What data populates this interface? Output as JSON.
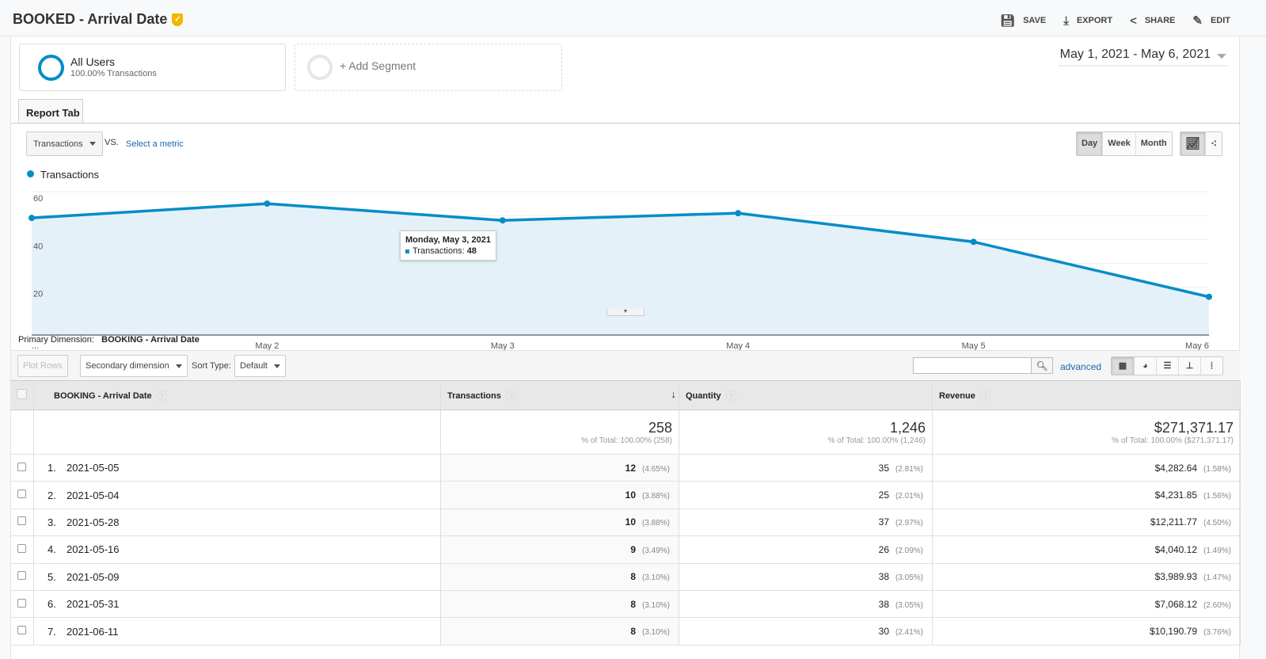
{
  "header": {
    "title": "BOOKED - Arrival Date",
    "actions": [
      {
        "icon": "save-icon",
        "label": "SAVE"
      },
      {
        "icon": "export-icon",
        "label": "EXPORT"
      },
      {
        "icon": "share-icon",
        "label": "SHARE"
      },
      {
        "icon": "edit-icon",
        "label": "EDIT"
      }
    ]
  },
  "segments": {
    "all_users": "All Users",
    "all_users_sub": "100.00% Transactions",
    "add": "+ Add Segment"
  },
  "date_range": "May 1, 2021 - May 6, 2021",
  "tab": "Report Tab",
  "controls": {
    "metric": "Transactions",
    "vs": "VS.",
    "select_metric": "Select a metric",
    "granularity": [
      "Day",
      "Week",
      "Month"
    ],
    "active_granularity": "Day"
  },
  "colors": {
    "accent": "#058dc7",
    "fill": "#e5f1f8",
    "badge": "#f4b400"
  },
  "chart_data": {
    "type": "area",
    "legend": "Transactions",
    "x": [
      "May 1",
      "May 2",
      "May 3",
      "May 4",
      "May 5",
      "May 6"
    ],
    "x_tick_labels": [
      "...",
      "May 2",
      "May 3",
      "May 4",
      "May 5",
      "May 6"
    ],
    "series": [
      {
        "name": "Transactions",
        "values": [
          49,
          55,
          48,
          51,
          39,
          16
        ]
      }
    ],
    "y_ticks": [
      "20",
      "40",
      "60"
    ],
    "ylim": [
      0,
      60
    ],
    "grid": true,
    "tooltip": {
      "title": "Monday, May 3, 2021",
      "label": "Transactions:",
      "value": "48"
    }
  },
  "dimension": {
    "label": "Primary Dimension:",
    "value": "BOOKING - Arrival Date"
  },
  "toolbar": {
    "plot_rows": "Plot Rows",
    "secondary": "Secondary dimension",
    "sort_type": "Sort Type:",
    "sort_value": "Default",
    "search_placeholder": "",
    "advanced": "advanced"
  },
  "table": {
    "headers": [
      "BOOKING - Arrival Date",
      "Transactions",
      "Quantity",
      "Revenue"
    ],
    "totals": [
      {
        "value": "258",
        "sub": "% of Total: 100.00% (258)"
      },
      {
        "value": "1,246",
        "sub": "% of Total: 100.00% (1,246)"
      },
      {
        "value": "$271,371.17",
        "sub": "% of Total: 100.00% ($271,371.17)"
      }
    ],
    "rows": [
      {
        "n": "1.",
        "date": "2021-05-05",
        "t": "12",
        "tp": "(4.65%)",
        "q": "35",
        "qp": "(2.81%)",
        "r": "$4,282.64",
        "rp": "(1.58%)"
      },
      {
        "n": "2.",
        "date": "2021-05-04",
        "t": "10",
        "tp": "(3.88%)",
        "q": "25",
        "qp": "(2.01%)",
        "r": "$4,231.85",
        "rp": "(1.56%)"
      },
      {
        "n": "3.",
        "date": "2021-05-28",
        "t": "10",
        "tp": "(3.88%)",
        "q": "37",
        "qp": "(2.97%)",
        "r": "$12,211.77",
        "rp": "(4.50%)"
      },
      {
        "n": "4.",
        "date": "2021-05-16",
        "t": "9",
        "tp": "(3.49%)",
        "q": "26",
        "qp": "(2.09%)",
        "r": "$4,040.12",
        "rp": "(1.49%)"
      },
      {
        "n": "5.",
        "date": "2021-05-09",
        "t": "8",
        "tp": "(3.10%)",
        "q": "38",
        "qp": "(3.05%)",
        "r": "$3,989.93",
        "rp": "(1.47%)"
      },
      {
        "n": "6.",
        "date": "2021-05-31",
        "t": "8",
        "tp": "(3.10%)",
        "q": "38",
        "qp": "(3.05%)",
        "r": "$7,068.12",
        "rp": "(2.60%)"
      },
      {
        "n": "7.",
        "date": "2021-06-11",
        "t": "8",
        "tp": "(3.10%)",
        "q": "30",
        "qp": "(2.41%)",
        "r": "$10,190.79",
        "rp": "(3.76%)"
      }
    ]
  }
}
